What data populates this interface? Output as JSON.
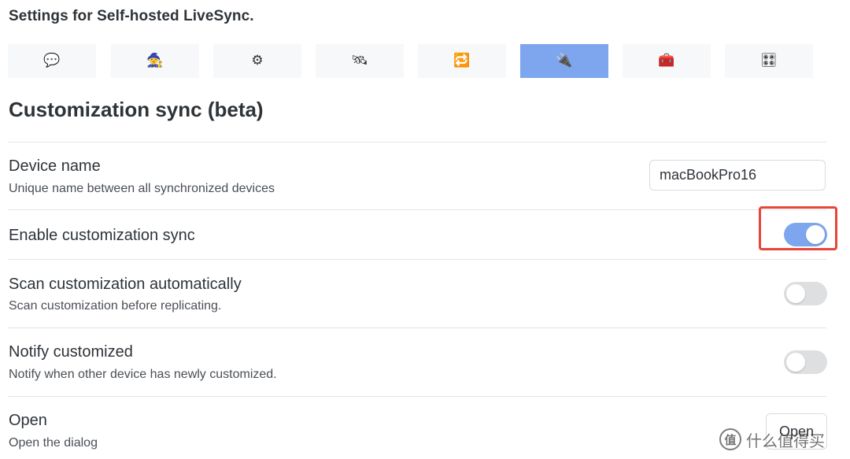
{
  "header": {
    "title": "Settings for Self-hosted LiveSync."
  },
  "tabs": [
    {
      "icon": "speech-bubble-icon",
      "glyph": "💬",
      "active": false
    },
    {
      "icon": "wizard-icon",
      "glyph": "🧙",
      "active": false
    },
    {
      "icon": "gear-icon",
      "glyph": "⚙",
      "active": false
    },
    {
      "icon": "satellite-icon",
      "glyph": "🛰",
      "active": false
    },
    {
      "icon": "sync-arrows-icon",
      "glyph": "🔁",
      "active": false
    },
    {
      "icon": "plug-icon",
      "glyph": "🔌",
      "active": true
    },
    {
      "icon": "toolbox-icon",
      "glyph": "🧰",
      "active": false
    },
    {
      "icon": "control-knobs-icon",
      "glyph": "🎛",
      "active": false
    }
  ],
  "section": {
    "title": "Customization sync (beta)"
  },
  "settings": {
    "device_name": {
      "name": "Device name",
      "desc": "Unique name between all synchronized devices",
      "value": "macBookPro16"
    },
    "enable_sync": {
      "name": "Enable customization sync",
      "enabled": true
    },
    "scan_auto": {
      "name": "Scan customization automatically",
      "desc": "Scan customization before replicating.",
      "enabled": false
    },
    "notify": {
      "name": "Notify customized",
      "desc": "Notify when other device has newly customized.",
      "enabled": false
    },
    "open": {
      "name": "Open",
      "desc": "Open the dialog",
      "button_label": "Open"
    }
  },
  "watermark": {
    "logo_glyph": "值",
    "text": "什么值得买"
  },
  "colors": {
    "accent": "#7ea6ee",
    "highlight": "#e8453a"
  }
}
